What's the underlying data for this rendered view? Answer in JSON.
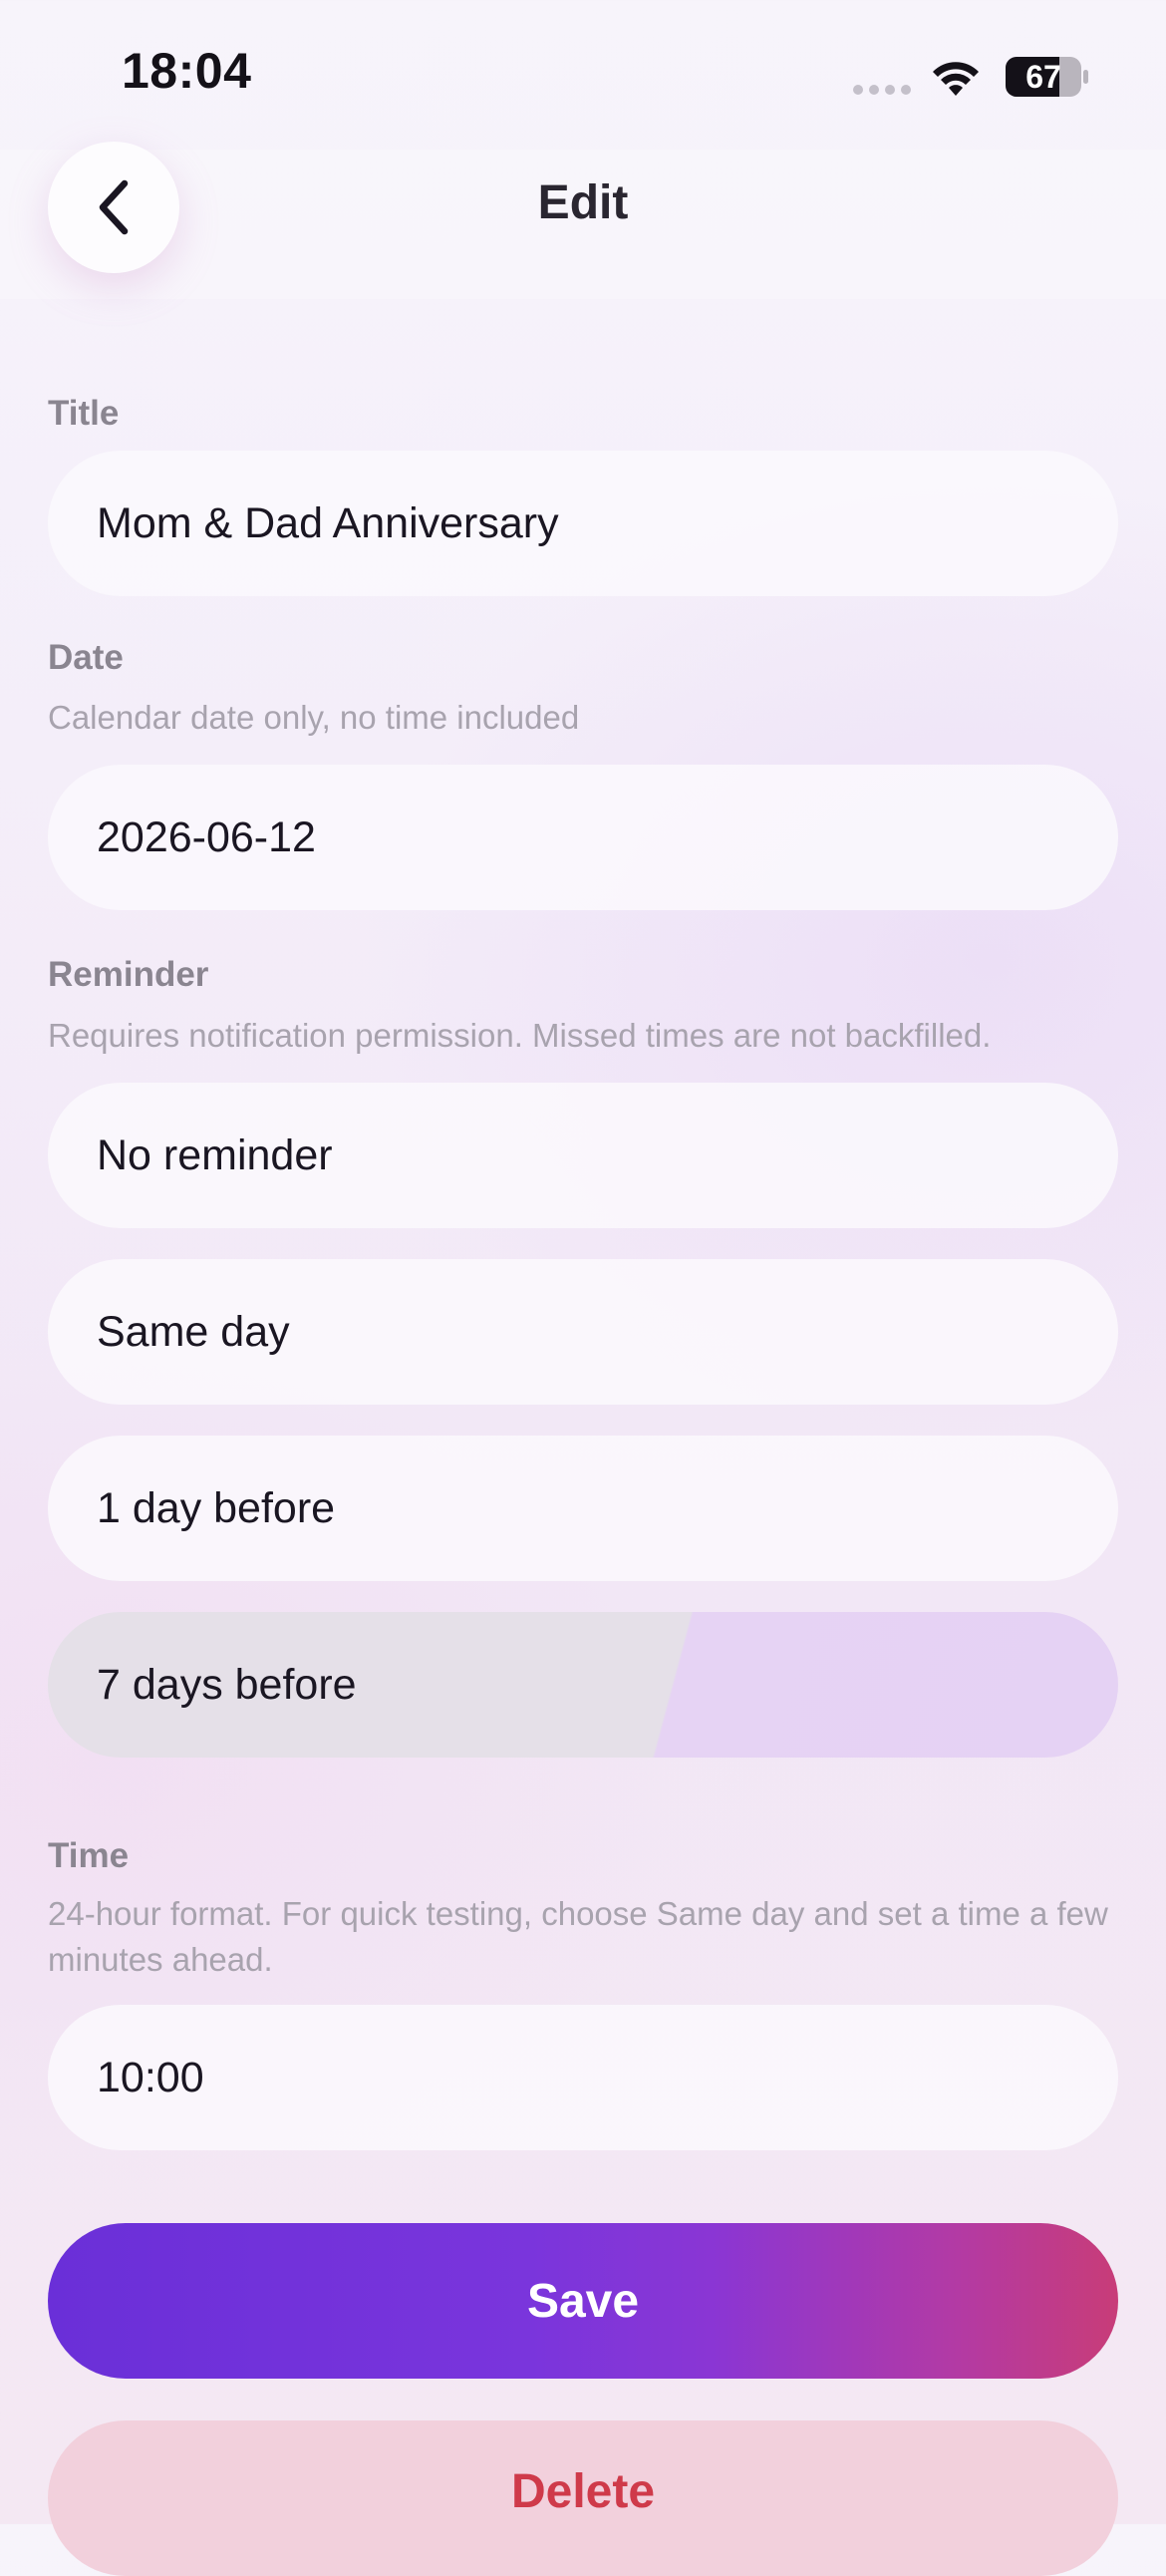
{
  "status_bar": {
    "time": "18:04",
    "battery": "67",
    "icons": [
      "signal-icon",
      "wifi-icon",
      "battery-icon"
    ]
  },
  "header": {
    "title": "Edit",
    "back_icon": "chevron-left-icon"
  },
  "form": {
    "title": {
      "label": "Title",
      "value": "Mom & Dad Anniversary"
    },
    "date": {
      "label": "Date",
      "hint": "Calendar date only, no time included",
      "value": "2026-06-12"
    },
    "reminder": {
      "label": "Reminder",
      "hint": "Requires notification permission. Missed times are not backfilled.",
      "options": [
        {
          "label": "No reminder",
          "selected": false
        },
        {
          "label": "Same day",
          "selected": false
        },
        {
          "label": "1 day before",
          "selected": false
        },
        {
          "label": "7 days before",
          "selected": true
        }
      ]
    },
    "time": {
      "label": "Time",
      "hint": "24-hour format. For quick testing, choose Same day and set a time a few minutes ahead.",
      "value": "10:00"
    }
  },
  "actions": {
    "save_label": "Save",
    "delete_label": "Delete"
  },
  "colors": {
    "accent_start": "#6a2fd8",
    "accent_end": "#c83c78",
    "delete_text": "#cf3a4a",
    "delete_bg": "#f2d0dc",
    "selected_option_bg": "#e5d2f4"
  }
}
